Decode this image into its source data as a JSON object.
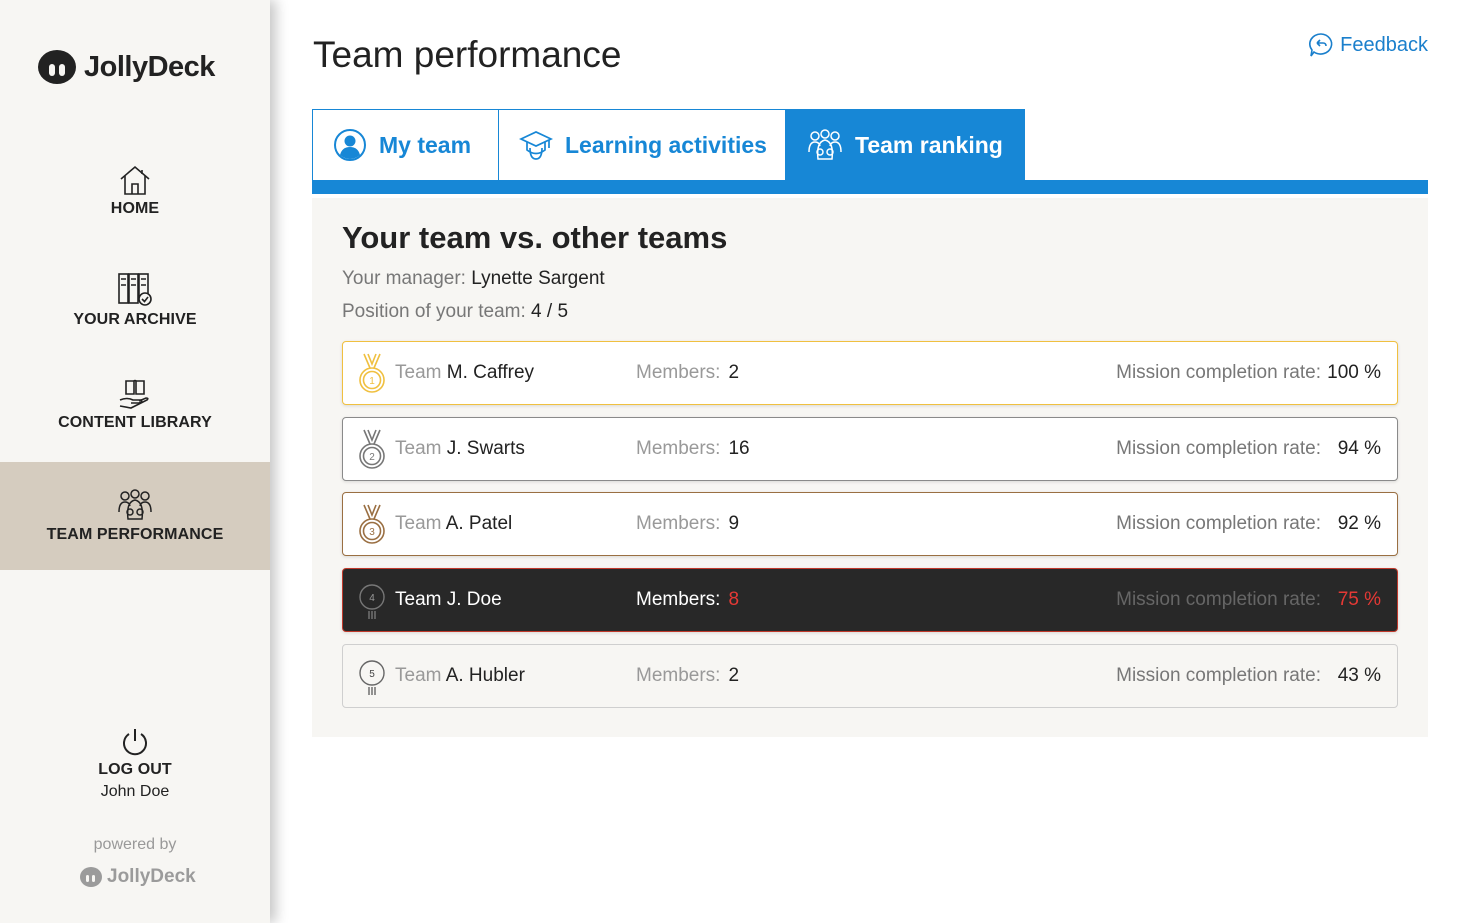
{
  "brand": {
    "name": "JollyDeck"
  },
  "sidebar": {
    "items": [
      {
        "label": "HOME",
        "icon": "home-icon"
      },
      {
        "label": "YOUR ARCHIVE",
        "icon": "archive-icon"
      },
      {
        "label": "CONTENT LIBRARY",
        "icon": "library-icon"
      },
      {
        "label": "TEAM PERFORMANCE",
        "icon": "team-icon",
        "active": true
      }
    ],
    "logout_label": "LOG OUT",
    "user_name": "John Doe",
    "powered_by": "powered by",
    "powered_brand": "JollyDeck"
  },
  "header": {
    "title": "Team performance",
    "feedback_label": "Feedback"
  },
  "tabs": [
    {
      "label": "My team",
      "icon": "user-icon"
    },
    {
      "label": "Learning activities",
      "icon": "graduation-cap-icon"
    },
    {
      "label": "Team ranking",
      "icon": "team-icon",
      "active": true
    }
  ],
  "panel": {
    "title": "Your team vs. other teams",
    "manager_label": "Your manager:",
    "manager_name": "Lynette Sargent",
    "position_label": "Position of your team:",
    "position_value": "4 / 5"
  },
  "ranking": {
    "team_label": "Team",
    "members_label": "Members:",
    "rate_label": "Mission completion rate:",
    "rows": [
      {
        "rank": "1",
        "name": "M. Caffrey",
        "members": "2",
        "rate": "100 %"
      },
      {
        "rank": "2",
        "name": "J. Swarts",
        "members": "16",
        "rate": "94 %"
      },
      {
        "rank": "3",
        "name": "A. Patel",
        "members": "9",
        "rate": "92 %"
      },
      {
        "rank": "4",
        "name": "J. Doe",
        "members": "8",
        "rate": "75 %",
        "own": true
      },
      {
        "rank": "5",
        "name": "A. Hubler",
        "members": "2",
        "rate": "43 %"
      }
    ]
  },
  "colors": {
    "accent": "#1787d6",
    "active_nav": "#d5ccbf",
    "gold": "#f0c040",
    "silver": "#8a8a8a",
    "bronze": "#9a6f42",
    "own_row_bg": "#282828",
    "own_row_highlight": "#e53935"
  }
}
